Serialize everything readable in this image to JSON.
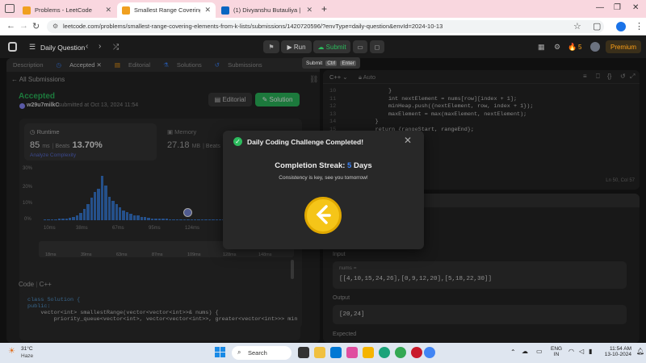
{
  "browser": {
    "tabs": [
      {
        "title": "Problems - LeetCode",
        "icon_color": "#f0a020"
      },
      {
        "title": "Smallest Range Covering Eleme",
        "icon_color": "#f0a020"
      },
      {
        "title": "(1) Divyanshu Butauliya | Linke",
        "icon_color": "#0a66c2"
      }
    ],
    "url": "leetcode.com/problems/smallest-range-covering-elements-from-k-lists/submissions/1420720596/?envType=daily-question&envId=2024-10-13"
  },
  "leetcode_bar": {
    "daily_question": "Daily Question",
    "run_label": "Run",
    "submit_label": "Submit",
    "streak_count": "5",
    "premium_label": "Premium",
    "tooltip": {
      "submit": "Submit",
      "ctrl": "Ctrl",
      "enter": "Enter"
    }
  },
  "left_panel": {
    "tabs": [
      "Description",
      "Accepted",
      "Editorial",
      "Solutions",
      "Submissions"
    ],
    "back_label": "All Submissions",
    "status": "Accepted",
    "username": "w29u7milkC",
    "submitted_text": "submitted at Oct 13, 2024 11:54",
    "editorial_button": "Editorial",
    "solution_button": "Solution",
    "runtime_label": "Runtime",
    "runtime_value": "85",
    "runtime_unit": "ms",
    "beats_label": "Beats",
    "beats_value": "13.70%",
    "analyze_label": "Analyze Complexity",
    "memory_label": "Memory",
    "memory_value": "27.18",
    "memory_unit": "MB",
    "memory_beats_label": "Beats",
    "memory_beats_value": "1",
    "y_axis": [
      "30%",
      "20%",
      "10%",
      "0%"
    ],
    "x_axis": [
      "10ms",
      "38ms",
      "67ms",
      "95ms",
      "124ms"
    ],
    "mini_axis": [
      "18ms",
      "39ms",
      "63ms",
      "87ms",
      "109ms",
      "128ms",
      "148ms"
    ],
    "code_label": "Code",
    "language": "C++",
    "code_lines": [
      "class Solution {",
      "public:",
      "    vector<int> smallestRange(vector<vector<int>>& nums) {",
      "",
      "        priority_queue<vector<int>, vector<vector<int>>, greater<vector<int>>> min"
    ]
  },
  "chart_data": {
    "type": "bar",
    "title": "",
    "xlabel": "",
    "ylabel": "",
    "ylim": [
      0,
      30
    ],
    "x_ticks": [
      "10ms",
      "38ms",
      "67ms",
      "95ms",
      "124ms"
    ],
    "y_ticks": [
      "30%",
      "20%",
      "10%",
      "0%"
    ],
    "values": [
      0.5,
      0.6,
      0.5,
      0.6,
      0.8,
      0.8,
      1,
      1.5,
      2,
      3,
      4.5,
      7,
      10,
      14,
      18,
      20,
      28,
      22,
      15,
      12,
      10,
      8,
      6,
      5,
      4,
      3,
      3,
      2,
      2,
      1.5,
      1.2,
      1,
      1,
      0.8,
      0.8,
      0.7,
      0.6,
      0.6,
      0.5,
      0.5,
      0.5,
      0.5,
      0.5,
      0.4,
      0.4,
      0.4,
      0.4,
      0.4,
      0.4,
      0.3,
      0.3,
      0.3,
      0.3,
      0.3,
      0.3,
      0.3,
      0.3,
      0.3,
      0.3,
      0.3,
      0.3,
      0.3,
      0.3,
      0.3,
      0.3,
      0.3,
      0.3,
      0.3,
      0.3,
      0.3
    ],
    "marker_index": 40
  },
  "right_panel": {
    "language": "C++",
    "auto_label": "Auto",
    "line_numbers": [
      "10",
      "11",
      "12",
      "13",
      "14",
      "15",
      "16"
    ],
    "code_lines": [
      "            }",
      "            int nextElement = nums[row][index + 1];",
      "            minHeap.push({nextElement, row, index + 1});",
      "            maxElement = max(maxElement, nextElement);",
      "        }",
      "        return {rangeStart, rangeEnd};",
      "    }"
    ],
    "cursor_pos": "Ln 50, Col 57",
    "input_label": "Input",
    "input_var": "nums =",
    "input_value": "[[4,10,15,24,26],[0,9,12,20],[5,18,22,30]]",
    "output_label": "Output",
    "output_value": "[20,24]",
    "expected_label": "Expected"
  },
  "modal": {
    "title": "Daily Coding Challenge Completed!",
    "streak_label": "Completion Streak:",
    "streak_value": "5",
    "streak_unit": "Days",
    "subtitle": "Consistency is key, see you tomorrow!"
  },
  "taskbar": {
    "weather_temp": "31°C",
    "weather_desc": "Haze",
    "search_placeholder": "Search",
    "lang": "ENG",
    "region": "IN",
    "time": "11:54 AM",
    "date": "13-10-2024"
  }
}
